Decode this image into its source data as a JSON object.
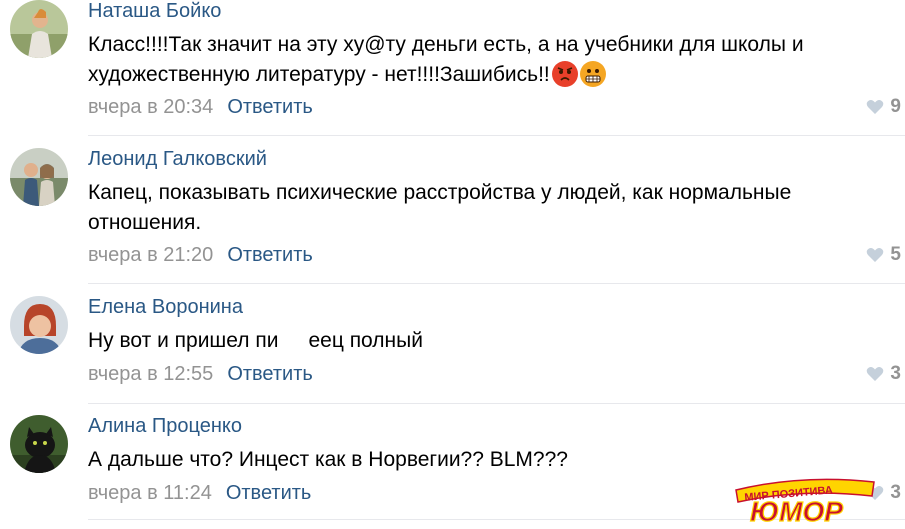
{
  "comments": [
    {
      "author": "Наташа Бойко",
      "text": "Класс!!!!Так значит на эту ху@ту деньги есть, а на учебники для школы и художественную литературу - нет!!!!Зашибись!!",
      "emojis": [
        "angry-face-icon",
        "grimacing-face-icon"
      ],
      "time": "вчера в 20:34",
      "reply": "Ответить",
      "likes": "9"
    },
    {
      "author": "Леонид Галковский",
      "text": "Капец, показывать психические расстройства у людей, как нормальные отношения.",
      "time": "вчера в 21:20",
      "reply": "Ответить",
      "likes": "5"
    },
    {
      "author": "Елена Воронина",
      "text_before": "Ну вот и пришел пи",
      "text_after": "еец полный",
      "time": "вчера в 12:55",
      "reply": "Ответить",
      "likes": "3"
    },
    {
      "author": "Алина Проценко",
      "text": "А дальше что? Инцест как в Норвегии?? BLM???",
      "time": "вчера в 11:24",
      "reply": "Ответить",
      "likes": "3"
    }
  ],
  "watermark": {
    "line1": "МИР ПОЗИТИВА",
    "line2": "ЮМОР"
  },
  "colors": {
    "link": "#2a5885",
    "meta": "#939393",
    "divider": "#e7e8ec"
  }
}
